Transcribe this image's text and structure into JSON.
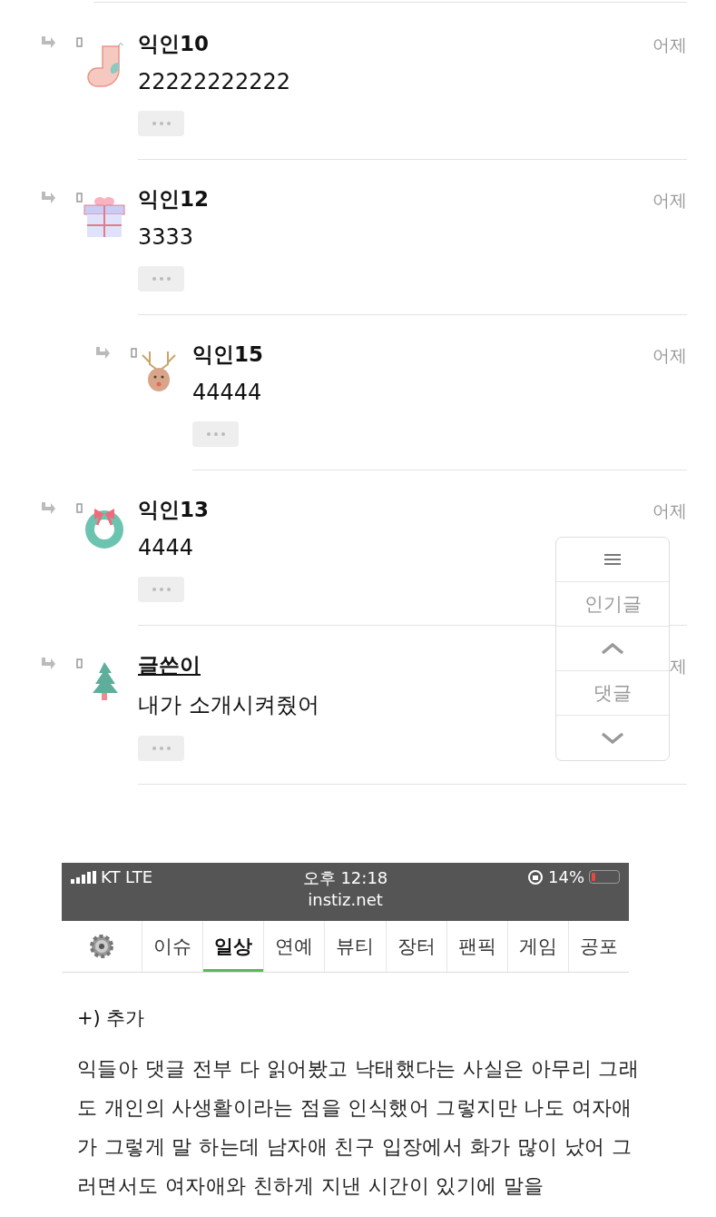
{
  "comments": [
    {
      "name": "익인10",
      "text": "22222222222",
      "time": "어제",
      "is_author": false
    },
    {
      "name": "익인12",
      "text": "3333",
      "time": "어제",
      "is_author": false,
      "children": [
        {
          "name": "익인15",
          "text": "44444",
          "time": "어제",
          "is_author": false
        }
      ]
    },
    {
      "name": "익인13",
      "text": "4444",
      "time": "어제",
      "is_author": false
    },
    {
      "name": "글쓴이",
      "text": "내가 소개시켜줬어",
      "time": "제",
      "is_author": true
    }
  ],
  "float_menu": {
    "popular": "인기글",
    "comments": "댓글"
  },
  "screenshot": {
    "status_bar": {
      "carrier": "KT LTE",
      "time": "오후 12:18",
      "battery": "14%",
      "url": "instiz.net"
    },
    "tabs": [
      {
        "label": "이슈",
        "selected": false
      },
      {
        "label": "일상",
        "selected": true
      },
      {
        "label": "연예",
        "selected": false
      },
      {
        "label": "뷰티",
        "selected": false
      },
      {
        "label": "장터",
        "selected": false
      },
      {
        "label": "팬픽",
        "selected": false
      },
      {
        "label": "게임",
        "selected": false
      },
      {
        "label": "공포",
        "selected": false
      }
    ]
  },
  "post": {
    "heading": "+) 추가",
    "paragraph": "익들아 댓글 전부 다 읽어봤고 낙태했다는 사실은 아무리 그래도 개인의 사생활이라는 점을 인식했어 그렇지만 나도 여자애가 그렇게 말 하는데 남자애 친구 입장에서 화가 많이 났어 그러면서도 여자애와 친하게 지낸 시간이 있기에 말을"
  }
}
